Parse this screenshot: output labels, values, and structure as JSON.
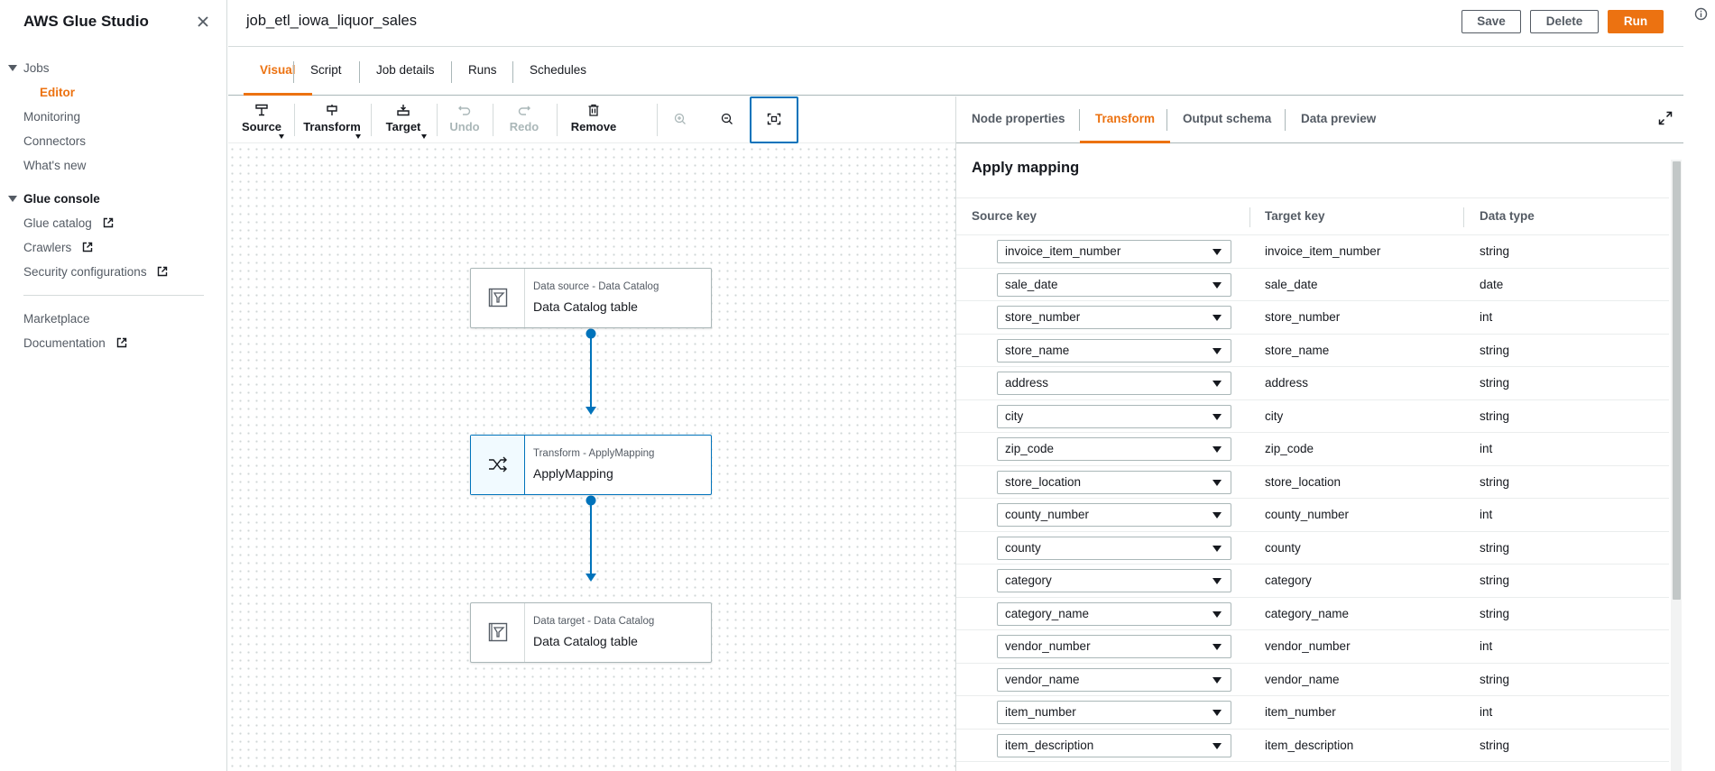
{
  "sidebar": {
    "title": "AWS Glue Studio",
    "sections": [
      {
        "label": "Jobs",
        "items": [
          {
            "label": "Editor",
            "active": true,
            "sub": true
          }
        ]
      },
      {
        "items": [
          {
            "label": "Monitoring"
          },
          {
            "label": "Connectors"
          },
          {
            "label": "What's new"
          }
        ]
      },
      {
        "label": "Glue console",
        "items": [
          {
            "label": "Glue catalog",
            "external": true
          },
          {
            "label": "Crawlers",
            "external": true
          },
          {
            "label": "Security configurations",
            "external": true
          }
        ]
      },
      {
        "items": [
          {
            "label": "Marketplace"
          },
          {
            "label": "Documentation",
            "external": true
          }
        ]
      }
    ]
  },
  "header": {
    "job_name": "job_etl_iowa_liquor_sales",
    "save_label": "Save",
    "delete_label": "Delete",
    "run_label": "Run"
  },
  "tabs": [
    "Visual",
    "Script",
    "Job details",
    "Runs",
    "Schedules"
  ],
  "toolbar": {
    "source": "Source",
    "transform": "Transform",
    "target": "Target",
    "undo": "Undo",
    "redo": "Redo",
    "remove": "Remove"
  },
  "nodes": [
    {
      "type": "Data source - Data Catalog",
      "label": "Data Catalog table"
    },
    {
      "type": "Transform - ApplyMapping",
      "label": "ApplyMapping",
      "selected": true
    },
    {
      "type": "Data target - Data Catalog",
      "label": "Data Catalog table"
    }
  ],
  "panel": {
    "tabs": [
      "Node properties",
      "Transform",
      "Output schema",
      "Data preview"
    ],
    "active_tab": "Transform",
    "title": "Apply mapping",
    "columns": [
      "Source key",
      "Target key",
      "Data type"
    ],
    "rows": [
      {
        "source": "invoice_item_number",
        "target": "invoice_item_number",
        "type": "string"
      },
      {
        "source": "sale_date",
        "target": "sale_date",
        "type": "date"
      },
      {
        "source": "store_number",
        "target": "store_number",
        "type": "int"
      },
      {
        "source": "store_name",
        "target": "store_name",
        "type": "string"
      },
      {
        "source": "address",
        "target": "address",
        "type": "string"
      },
      {
        "source": "city",
        "target": "city",
        "type": "string"
      },
      {
        "source": "zip_code",
        "target": "zip_code",
        "type": "int"
      },
      {
        "source": "store_location",
        "target": "store_location",
        "type": "string"
      },
      {
        "source": "county_number",
        "target": "county_number",
        "type": "int"
      },
      {
        "source": "county",
        "target": "county",
        "type": "string"
      },
      {
        "source": "category",
        "target": "category",
        "type": "string"
      },
      {
        "source": "category_name",
        "target": "category_name",
        "type": "string"
      },
      {
        "source": "vendor_number",
        "target": "vendor_number",
        "type": "int"
      },
      {
        "source": "vendor_name",
        "target": "vendor_name",
        "type": "string"
      },
      {
        "source": "item_number",
        "target": "item_number",
        "type": "int"
      },
      {
        "source": "item_description",
        "target": "item_description",
        "type": "string"
      }
    ]
  },
  "colors": {
    "accent": "#ec7211",
    "link_blue": "#0073bb"
  }
}
